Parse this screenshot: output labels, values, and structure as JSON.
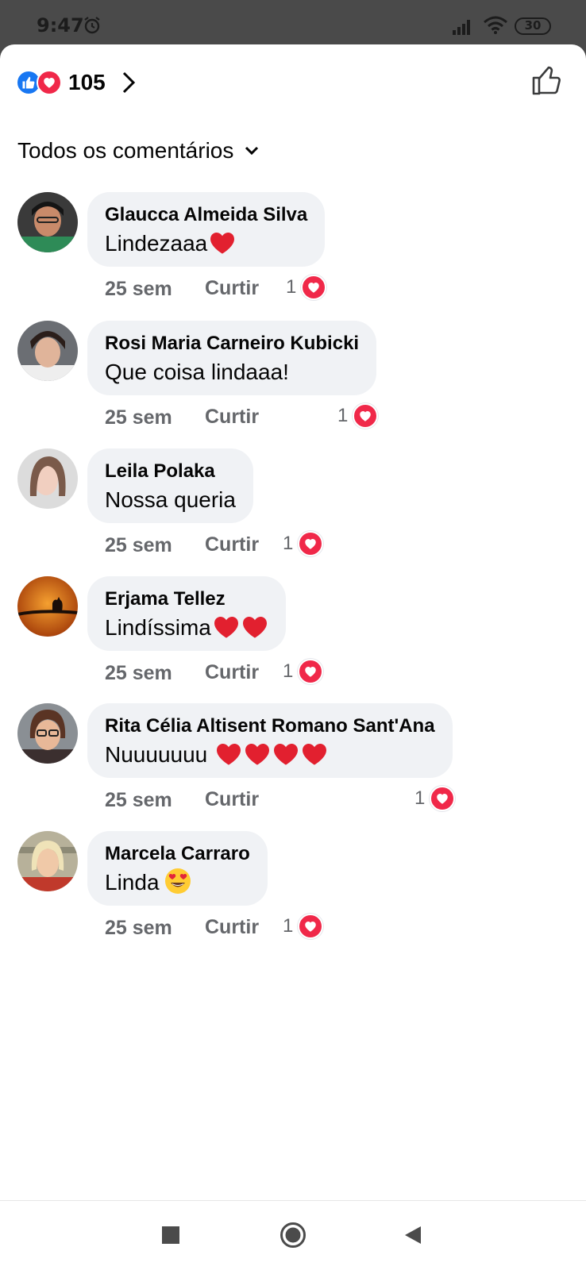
{
  "status_bar": {
    "time": "9:47",
    "battery": "30",
    "icons": [
      "alarm-icon",
      "signal-icon",
      "wifi-icon",
      "battery-icon"
    ]
  },
  "header": {
    "reactions_count": "105",
    "reaction_icons": [
      "like-icon",
      "love-icon"
    ]
  },
  "filter": {
    "label": "Todos os comentários"
  },
  "comments": [
    {
      "author": "Glaucca Almeida Silva",
      "text": "Lindezaaa",
      "emojis": [
        "heart"
      ],
      "time": "25 sem",
      "like_label": "Curtir",
      "reactions": "1"
    },
    {
      "author": "Rosi Maria Carneiro Kubicki",
      "text": "Que coisa lindaaa!",
      "emojis": [],
      "time": "25 sem",
      "like_label": "Curtir",
      "reactions": "1"
    },
    {
      "author": "Leila Polaka",
      "text": "Nossa queria",
      "emojis": [],
      "time": "25 sem",
      "like_label": "Curtir",
      "reactions": "1"
    },
    {
      "author": "Erjama Tellez",
      "text": "Lindíssima",
      "emojis": [
        "heart",
        "heart"
      ],
      "time": "25 sem",
      "like_label": "Curtir",
      "reactions": "1"
    },
    {
      "author": "Rita Célia Altisent Romano Sant'Ana",
      "text": "Nuuuuuuu ",
      "emojis": [
        "heart",
        "heart",
        "heart",
        "heart"
      ],
      "time": "25 sem",
      "like_label": "Curtir",
      "reactions": "1"
    },
    {
      "author": "Marcela Carraro",
      "text": "Linda",
      "emojis": [
        "heart-eyes-face"
      ],
      "time": "25 sem",
      "like_label": "Curtir",
      "reactions": "1"
    }
  ],
  "colors": {
    "accent_blue": "#1877f2",
    "love_red": "#f02849",
    "bubble_bg": "#f0f2f5",
    "secondary_text": "#65676b"
  }
}
